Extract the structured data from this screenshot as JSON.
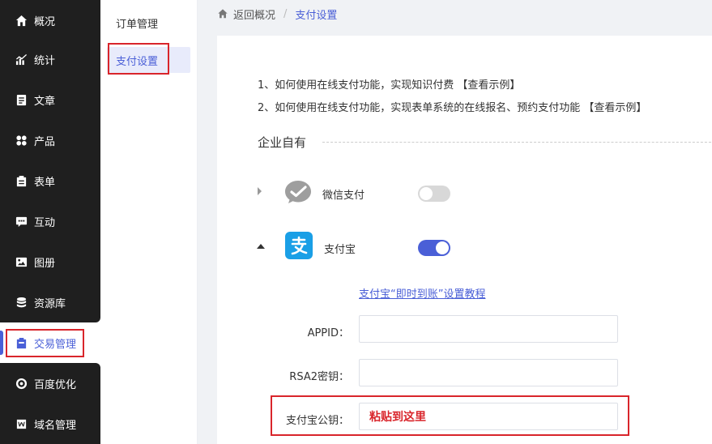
{
  "nav": {
    "items": [
      {
        "label": "概况",
        "icon": "home-icon"
      },
      {
        "label": "统计",
        "icon": "chart-icon"
      },
      {
        "label": "文章",
        "icon": "article-icon"
      },
      {
        "label": "产品",
        "icon": "grid-icon"
      },
      {
        "label": "表单",
        "icon": "clipboard-icon"
      },
      {
        "label": "互动",
        "icon": "chat-icon"
      },
      {
        "label": "图册",
        "icon": "image-icon"
      },
      {
        "label": "资源库",
        "icon": "database-icon"
      },
      {
        "label": "交易管理",
        "icon": "order-icon"
      },
      {
        "label": "百度优化",
        "icon": "target-icon"
      },
      {
        "label": "域名管理",
        "icon": "domain-icon"
      }
    ]
  },
  "subnav": {
    "items": [
      {
        "label": "订单管理"
      },
      {
        "label": "支付设置"
      }
    ]
  },
  "breadcrumb": {
    "back": "返回概况",
    "separator": "/",
    "current": "支付设置"
  },
  "help": {
    "line1_prefix": "1、如何使用在线支付功能，实现知识付费",
    "line1_link": "【查看示例】",
    "line2_prefix": "2、如何使用在线支付功能，实现表单系统的在线报名、预约支付功能",
    "line2_link": "【查看示例】"
  },
  "section": {
    "title": "企业自有"
  },
  "payments": {
    "wechat": {
      "label": "微信支付",
      "enabled": false
    },
    "alipay": {
      "label": "支付宝",
      "enabled": true
    }
  },
  "alipay_config": {
    "tutorial_link": "支付宝“即时到账”设置教程",
    "appid_label": "APPID：",
    "appid_value": "",
    "rsa2_label": "RSA2密钥：",
    "rsa2_value": "",
    "pubkey_label": "支付宝公钥：",
    "pubkey_value": "粘贴到这里"
  },
  "colors": {
    "accent": "#4a5fd7",
    "highlight": "#d9252b",
    "nav_bg": "#1f1f1f",
    "alipay_blue": "#1a9fe6"
  }
}
